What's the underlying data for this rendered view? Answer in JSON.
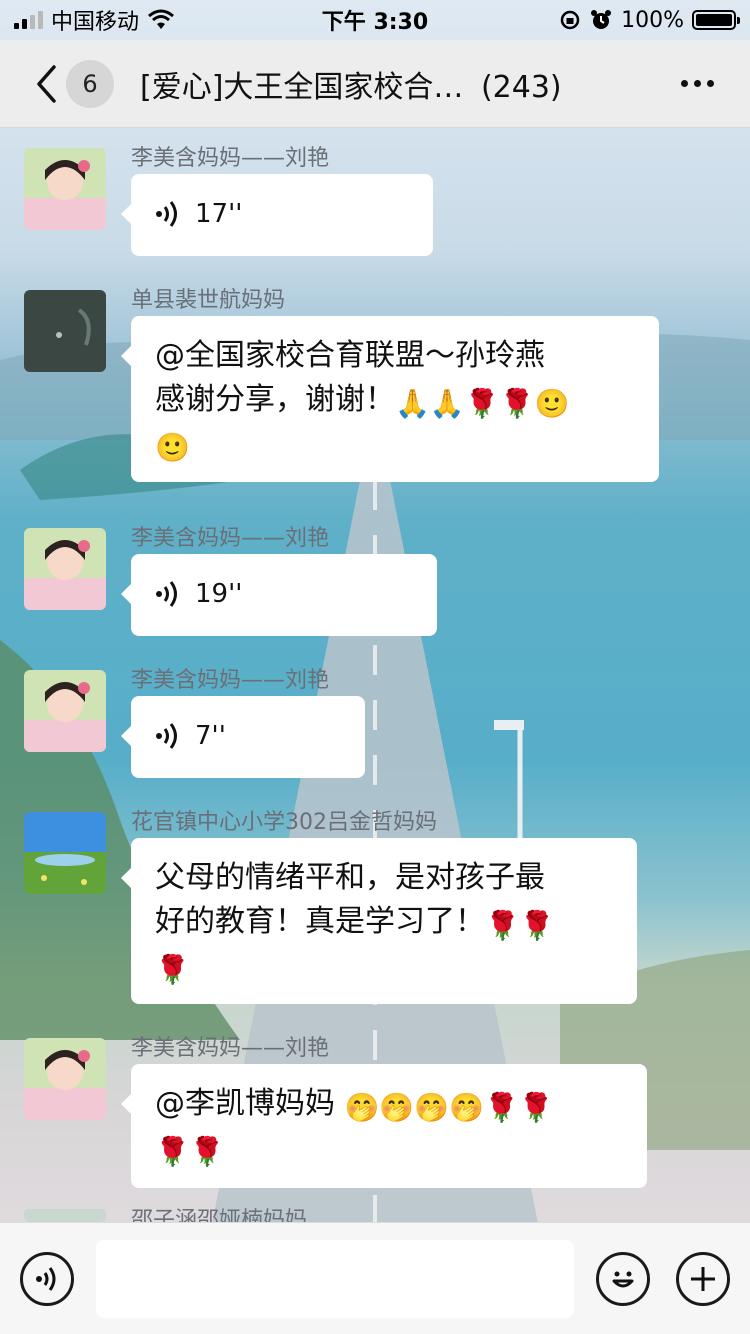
{
  "status_bar": {
    "carrier": "中国移动",
    "time": "下午 3:30",
    "battery": "100%"
  },
  "nav": {
    "unread_count": "6",
    "title": "[爱心]大王全国家校合…",
    "member_count": "(243)"
  },
  "messages": [
    {
      "sender": "李美含妈妈——刘艳",
      "type": "voice",
      "duration": "17''",
      "avatar": "girl-photo"
    },
    {
      "sender": "单县裴世航妈妈",
      "type": "text",
      "lines": [
        "@全国家校合育联盟～孙玲燕",
        "感谢分享，谢谢！"
      ],
      "emojis_line2": [
        "🙏",
        "🙏",
        "🌹",
        "🌹",
        "🙂"
      ],
      "emojis_line3": [
        "🙂"
      ],
      "avatar": "dark-photo"
    },
    {
      "sender": "李美含妈妈——刘艳",
      "type": "voice",
      "duration": "19''",
      "avatar": "girl-photo"
    },
    {
      "sender": "李美含妈妈——刘艳",
      "type": "voice",
      "duration": "7''",
      "avatar": "girl-photo"
    },
    {
      "sender": "花官镇中心小学302吕金哲妈妈",
      "type": "text",
      "lines": [
        "父母的情绪平和，是对孩子最",
        "好的教育！真是学习了！"
      ],
      "emojis_line2": [
        "🌹",
        "🌹"
      ],
      "emojis_line3": [
        "🌹"
      ],
      "avatar": "landscape-photo"
    },
    {
      "sender": "李美含妈妈——刘艳",
      "type": "text",
      "lines": [
        "@李凯博妈妈"
      ],
      "emojis_line1": [
        "🤭",
        "🤭",
        "🤭",
        "🤭",
        "🌹",
        "🌹"
      ],
      "emojis_line2": [
        "🌹",
        "🌹"
      ],
      "avatar": "girl-photo"
    },
    {
      "sender": "邵子涵邵娅楠妈妈",
      "type": "partial",
      "avatar": "partial-photo"
    }
  ],
  "input": {
    "placeholder": ""
  },
  "colors": {
    "bubble": "#ffffff",
    "nav_bg": "#ededed",
    "sender_text": "#6b6f77"
  }
}
